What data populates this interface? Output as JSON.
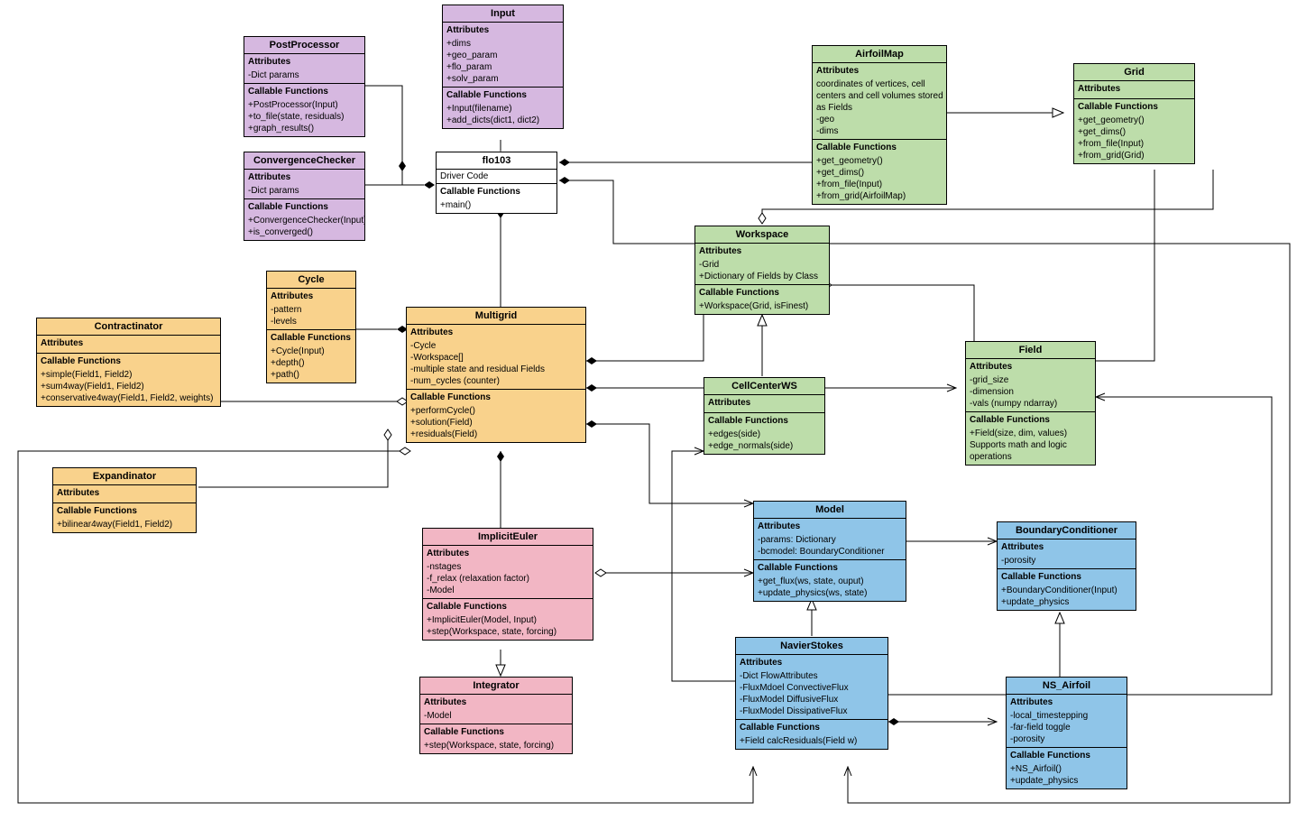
{
  "classes": {
    "input": {
      "title": "Input",
      "attrs_hdr": "Attributes",
      "attrs": [
        "+dims",
        "+geo_param",
        "+flo_param",
        "+solv_param"
      ],
      "funcs_hdr": "Callable Functions",
      "funcs": [
        "+Input(filename)",
        "+add_dicts(dict1, dict2)"
      ]
    },
    "postprocessor": {
      "title": "PostProcessor",
      "attrs_hdr": "Attributes",
      "attrs": [
        "-Dict params"
      ],
      "funcs_hdr": "Callable Functions",
      "funcs": [
        "+PostProcessor(Input)",
        "+to_file(state, residuals)",
        "+graph_results()"
      ]
    },
    "convergence": {
      "title": "ConvergenceChecker",
      "attrs_hdr": "Attributes",
      "attrs": [
        "-Dict params"
      ],
      "funcs_hdr": "Callable Functions",
      "funcs": [
        "+ConvergenceChecker(Input)",
        "+is_converged()"
      ]
    },
    "flo103": {
      "title": "flo103",
      "subtitle": "Driver Code",
      "funcs_hdr": "Callable Functions",
      "funcs": [
        "+main()"
      ]
    },
    "airfoilmap": {
      "title": "AirfoilMap",
      "attrs_hdr": "Attributes",
      "attrs": [
        "coordinates of vertices, cell",
        "centers and cell volumes stored",
        "as Fields",
        "-geo",
        "-dims"
      ],
      "funcs_hdr": "Callable Functions",
      "funcs": [
        "+get_geometry()",
        "+get_dims()",
        "+from_file(Input)",
        "+from_grid(AirfoilMap)"
      ]
    },
    "grid": {
      "title": "Grid",
      "attrs_hdr": "Attributes",
      "attrs": [],
      "funcs_hdr": "Callable Functions",
      "funcs": [
        "+get_geometry()",
        "+get_dims()",
        "+from_file(Input)",
        "+from_grid(Grid)"
      ]
    },
    "workspace": {
      "title": "Workspace",
      "attrs_hdr": "Attributes",
      "attrs": [
        "-Grid",
        "+Dictionary of Fields by Class"
      ],
      "funcs_hdr": "Callable Functions",
      "funcs": [
        "+Workspace(Grid, isFinest)"
      ]
    },
    "cellcenterws": {
      "title": "CellCenterWS",
      "attrs_hdr": "Attributes",
      "attrs": [],
      "funcs_hdr": "Callable Functions",
      "funcs": [
        "+edges(side)",
        "+edge_normals(side)"
      ]
    },
    "field": {
      "title": "Field",
      "attrs_hdr": "Attributes",
      "attrs": [
        "-grid_size",
        "-dimension",
        "-vals (numpy ndarray)"
      ],
      "funcs_hdr": "Callable Functions",
      "funcs": [
        "+Field(size, dim, values)",
        "Supports math and logic",
        "operations"
      ]
    },
    "cycle": {
      "title": "Cycle",
      "attrs_hdr": "Attributes",
      "attrs": [
        "-pattern",
        "-levels"
      ],
      "funcs_hdr": "Callable Functions",
      "funcs": [
        "+Cycle(Input)",
        "+depth()",
        "+path()"
      ]
    },
    "contractinator": {
      "title": "Contractinator",
      "attrs_hdr": "Attributes",
      "attrs": [],
      "funcs_hdr": "Callable Functions",
      "funcs": [
        "+simple(Field1, Field2)",
        "+sum4way(Field1, Field2)",
        "+conservative4way(Field1, Field2, weights)"
      ]
    },
    "expandinator": {
      "title": "Expandinator",
      "attrs_hdr": "Attributes",
      "attrs": [],
      "funcs_hdr": "Callable Functions",
      "funcs": [
        "+bilinear4way(Field1, Field2)"
      ]
    },
    "multigrid": {
      "title": "Multigrid",
      "attrs_hdr": "Attributes",
      "attrs": [
        "-Cycle",
        "-Workspace[]",
        "-multiple state and residual Fields",
        "-num_cycles (counter)"
      ],
      "funcs_hdr": "Callable Functions",
      "funcs": [
        "+performCycle()",
        "+solution(Field)",
        "+residuals(Field)"
      ]
    },
    "impliciteuler": {
      "title": "ImplicitEuler",
      "attrs_hdr": "Attributes",
      "attrs": [
        "-nstages",
        "-f_relax (relaxation factor)",
        "-Model"
      ],
      "funcs_hdr": "Callable Functions",
      "funcs": [
        "+ImplicitEuler(Model, Input)",
        "+step(Workspace, state, forcing)"
      ]
    },
    "integrator": {
      "title": "Integrator",
      "attrs_hdr": "Attributes",
      "attrs": [
        "-Model"
      ],
      "funcs_hdr": "Callable Functions",
      "funcs": [
        "+step(Workspace, state, forcing)"
      ]
    },
    "model": {
      "title": "Model",
      "attrs_hdr": "Attributes",
      "attrs": [
        "-params: Dictionary",
        "-bcmodel: BoundaryConditioner"
      ],
      "funcs_hdr": "Callable Functions",
      "funcs": [
        "+get_flux(ws, state, ouput)",
        "+update_physics(ws, state)"
      ]
    },
    "navierstokes": {
      "title": "NavierStokes",
      "attrs_hdr": "Attributes",
      "attrs": [
        "-Dict FlowAttributes",
        "-FluxMdoel ConvectiveFlux",
        "-FluxModel DiffusiveFlux",
        "-FluxModel DissipativeFlux"
      ],
      "funcs_hdr": "Callable Functions",
      "funcs": [
        "+Field calcResiduals(Field w)"
      ]
    },
    "boundarycond": {
      "title": "BoundaryConditioner",
      "attrs_hdr": "Attributes",
      "attrs": [
        "-porosity"
      ],
      "funcs_hdr": "Callable Functions",
      "funcs": [
        "+BoundaryConditioner(Input)",
        "+update_physics"
      ]
    },
    "nsairfoil": {
      "title": "NS_Airfoil",
      "attrs_hdr": "Attributes",
      "attrs": [
        "-local_timestepping",
        "-far-field toggle",
        "-porosity"
      ],
      "funcs_hdr": "Callable Functions",
      "funcs": [
        "+NS_Airfoil()",
        "+update_physics"
      ]
    }
  }
}
